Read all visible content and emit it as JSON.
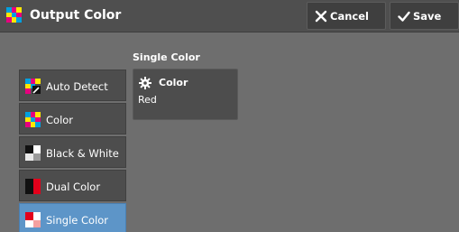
{
  "header": {
    "title": "Output Color",
    "title_icon": "color-mode-icon",
    "cancel_label": "Cancel",
    "save_label": "Save"
  },
  "nav": {
    "items": [
      {
        "label": "Auto Detect",
        "icon": "auto-detect-icon",
        "selected": false
      },
      {
        "label": "Color",
        "icon": "color-icon",
        "selected": false
      },
      {
        "label": "Black & White",
        "icon": "black-white-icon",
        "selected": false
      },
      {
        "label": "Dual Color",
        "icon": "dual-color-icon",
        "selected": false
      },
      {
        "label": "Single Color",
        "icon": "single-color-icon",
        "selected": true
      }
    ]
  },
  "main": {
    "section_title": "Single Color",
    "tile": {
      "icon": "gear-icon",
      "label": "Color",
      "value": "Red"
    }
  },
  "colors": {
    "background": "#6e6e6e",
    "header": "#4f4f4f",
    "button": "#4d4d4d",
    "selected": "#5d95c8"
  }
}
